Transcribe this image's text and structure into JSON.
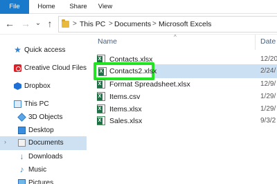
{
  "ribbon": {
    "tabs": [
      "File",
      "Home",
      "Share",
      "View"
    ]
  },
  "address_bar": {
    "folder_icon": "folder-icon",
    "breadcrumbs": [
      "This PC",
      "Documents",
      "Microsoft Excels"
    ],
    "separator": ">"
  },
  "nav_buttons": {
    "back": "←",
    "forward": "→",
    "recent": "⌄",
    "up": "↑"
  },
  "navigation_pane": {
    "items": [
      {
        "label": "Quick access",
        "icon": "star-icon"
      },
      {
        "label": "Creative Cloud Files",
        "icon": "creative-cloud-icon"
      },
      {
        "label": "Dropbox",
        "icon": "dropbox-icon"
      },
      {
        "label": "This PC",
        "icon": "computer-icon"
      },
      {
        "label": "3D Objects",
        "icon": "cube-icon"
      },
      {
        "label": "Desktop",
        "icon": "desktop-icon"
      },
      {
        "label": "Documents",
        "icon": "documents-icon",
        "selected": true
      },
      {
        "label": "Downloads",
        "icon": "download-icon"
      },
      {
        "label": "Music",
        "icon": "music-icon"
      },
      {
        "label": "Pictures",
        "icon": "pictures-icon"
      }
    ]
  },
  "columns": {
    "name": "Name",
    "date": "Date"
  },
  "files": [
    {
      "name": "Contacts.xlsx",
      "date": "12/20",
      "icon": "excel-file-icon"
    },
    {
      "name": "Contacts2.xlsx",
      "date": "2/24/",
      "icon": "excel-file-icon",
      "selected": true
    },
    {
      "name": "Format Spreadsheet.xlsx",
      "date": "12/9/",
      "icon": "excel-file-icon"
    },
    {
      "name": "Items.csv",
      "date": "1/29/",
      "icon": "excel-file-icon"
    },
    {
      "name": "Items.xlsx",
      "date": "1/29/",
      "icon": "excel-file-icon"
    },
    {
      "name": "Sales.xlsx",
      "date": "9/3/2",
      "icon": "excel-file-icon"
    }
  ],
  "colors": {
    "file_tab": "#1979ca",
    "selection": "#cde1f3",
    "highlight_border": "#22e422",
    "excel_green": "#1e7145"
  }
}
